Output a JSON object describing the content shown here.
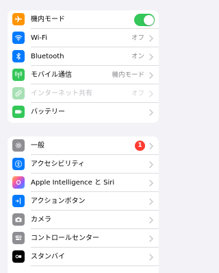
{
  "colors": {
    "background": "#f2f2f7",
    "toggle_on": "#34c759",
    "badge": "#ff3b30",
    "airplane": "#ff9500",
    "wifi": "#007aff",
    "bluetooth": "#007aff",
    "cellular": "#34c759",
    "hotspot": "#a8e0b5",
    "battery": "#34c759",
    "general": "#8e8e93",
    "accessibility": "#007aff",
    "action_button": "#007aff",
    "camera": "#8e8e93",
    "control_center": "#8e8e93",
    "standby": "#000000"
  },
  "connectivity": {
    "airplane_mode": {
      "label": "機内モード",
      "icon": "airplane-icon",
      "toggle_on": true
    },
    "wifi": {
      "label": "Wi-Fi",
      "value": "オフ",
      "icon": "wifi-icon"
    },
    "bluetooth": {
      "label": "Bluetooth",
      "value": "オン",
      "icon": "bluetooth-icon"
    },
    "mobile_data": {
      "label": "モバイル通信",
      "value": "機内モード",
      "icon": "antenna-icon"
    },
    "hotspot": {
      "label": "インターネット共有",
      "value": "オフ",
      "icon": "link-icon",
      "disabled": true
    },
    "battery": {
      "label": "バッテリー",
      "icon": "battery-icon"
    }
  },
  "system": {
    "general": {
      "label": "一般",
      "badge": "1",
      "icon": "gear-icon"
    },
    "accessibility": {
      "label": "アクセシビリティ",
      "icon": "accessibility-icon"
    },
    "apple_intelligence": {
      "label": "Apple Intelligence と Siri",
      "icon": "siri-icon"
    },
    "action_button": {
      "label": "アクションボタン",
      "icon": "action-button-icon"
    },
    "camera": {
      "label": "カメラ",
      "icon": "camera-icon"
    },
    "control_center": {
      "label": "コントロールセンター",
      "icon": "control-center-icon"
    },
    "standby": {
      "label": "スタンバイ",
      "icon": "standby-icon"
    }
  }
}
